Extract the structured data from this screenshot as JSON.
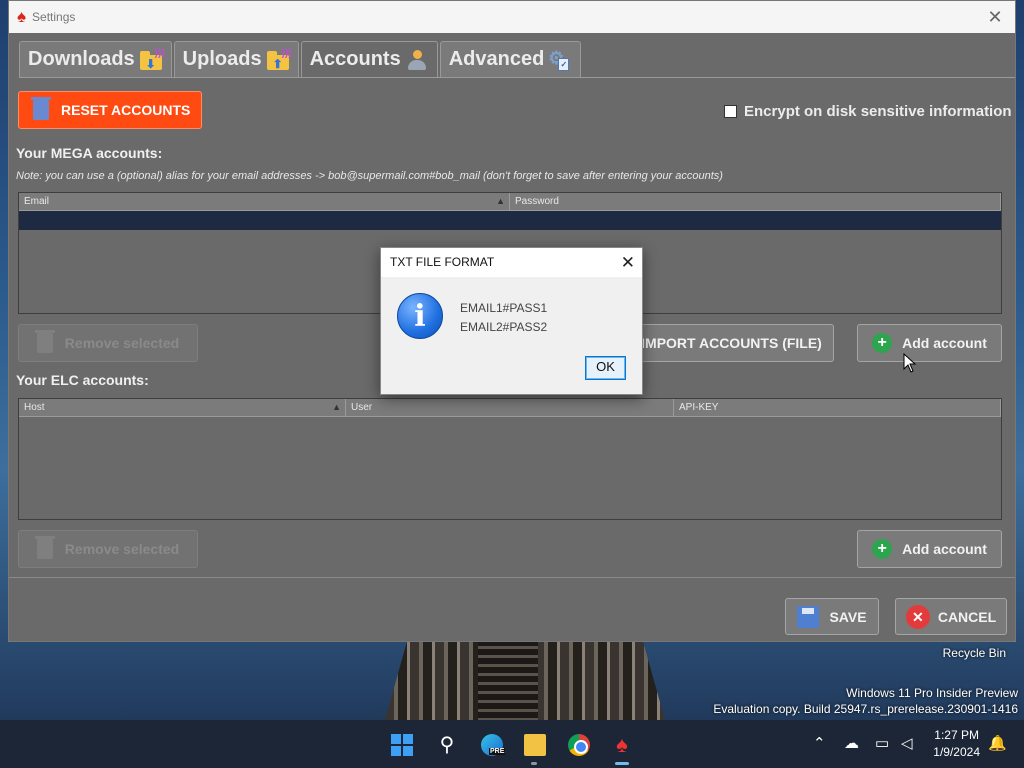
{
  "window": {
    "title": "Settings"
  },
  "tabs": [
    {
      "label": "Downloads"
    },
    {
      "label": "Uploads"
    },
    {
      "label": "Accounts"
    },
    {
      "label": "Advanced"
    }
  ],
  "accounts": {
    "reset_button": "RESET ACCOUNTS",
    "encrypt_label": "Encrypt on disk sensitive information",
    "mega_title": "Your MEGA accounts:",
    "mega_note": "Note: you can use a (optional) alias for your email addresses -> bob@supermail.com#bob_mail (don't forget to save after entering your accounts)",
    "mega_columns": [
      "Email",
      "Password"
    ],
    "remove_selected": "Remove selected",
    "import_button": "IMPORT ACCOUNTS (FILE)",
    "add_account": "Add account",
    "elc_title": "Your ELC accounts:",
    "elc_columns": [
      "Host",
      "User",
      "API-KEY"
    ],
    "sort_indicator": "▲"
  },
  "footer": {
    "save": "SAVE",
    "cancel": "CANCEL"
  },
  "dialog": {
    "title": "TXT FILE FORMAT",
    "line1": "EMAIL1#PASS1",
    "line2": "EMAIL2#PASS2",
    "ok": "OK"
  },
  "desktop": {
    "recycle_bin": "Recycle Bin",
    "watermark_line1": "Windows 11 Pro Insider Preview",
    "watermark_line2": "Evaluation copy. Build 25947.rs_prerelease.230901-1416"
  },
  "taskbar": {
    "edge_badge": "PRE",
    "time": "1:27 PM",
    "date": "1/9/2024"
  },
  "colors": {
    "reset_bg": "#ff4a12",
    "accent": "#0078d4",
    "add_green": "#2da44e",
    "cancel_red": "#e33b3b"
  }
}
